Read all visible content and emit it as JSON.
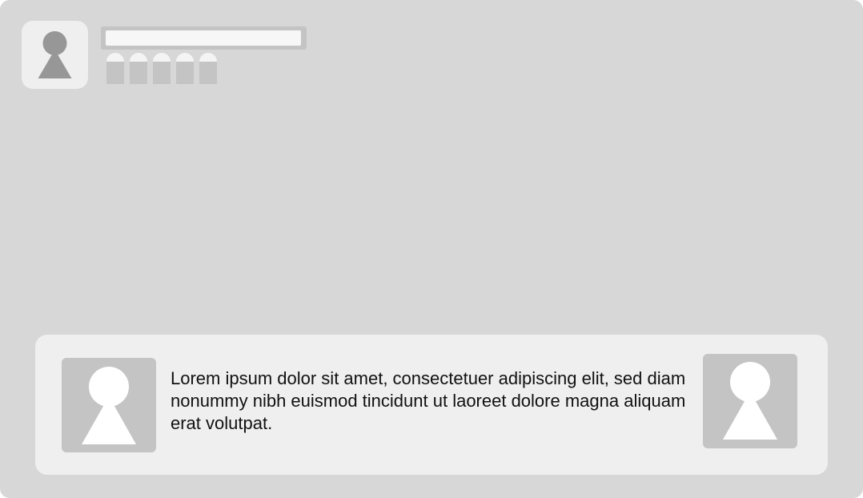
{
  "profile": {
    "name_value": "",
    "rating_chips": [
      {
        "icon": "rating-chip"
      },
      {
        "icon": "rating-chip"
      },
      {
        "icon": "rating-chip"
      },
      {
        "icon": "rating-chip"
      },
      {
        "icon": "rating-chip"
      }
    ]
  },
  "message": {
    "text": "Lorem ipsum dolor sit amet, consectetuer adipiscing elit, sed diam nonummy nibh euismod tincidunt ut laoreet dolore magna aliquam erat volutpat.",
    "left_avatar_icon": "user-placeholder-icon",
    "right_avatar_icon": "user-placeholder-icon"
  },
  "colors": {
    "background": "#d7d7d7",
    "card": "#efefef",
    "placeholder": "#c4c4c4",
    "profile_figure": "#979797",
    "message_figure": "#ffffff",
    "text": "#111111"
  }
}
